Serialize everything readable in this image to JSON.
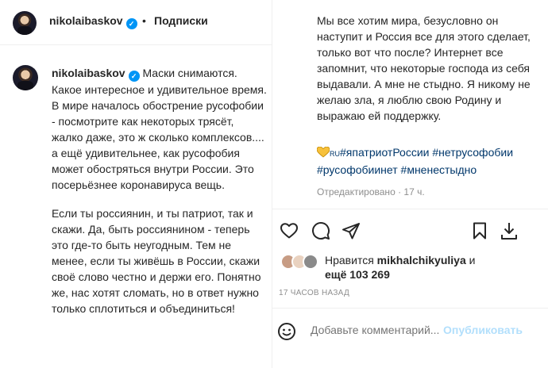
{
  "header": {
    "username": "nikolaibaskov",
    "separator": "•",
    "follow_label": "Подписки"
  },
  "caption": {
    "username": "nikolaibaskov",
    "paragraph1": "Маски снимаются. Какое интересное и удивительное время. В мире началось обострение русофобии - посмотрите как некоторых трясёт, жалко даже, это ж сколько комплексов.... а ещё удивительнее, как русофобия может обостряться внутри России. Это посерьёзнее коронавируса вещь.",
    "paragraph2": "Если ты россиянин, и ты патриот, так и скажи. Да, быть россиянином - теперь это где-то быть неугодным. Тем не менее, если ты живёшь в России, скажи своё слово честно и держи его. Понятно же, нас хотят сломать, но в ответ нужно только сплотиться и объединиться!"
  },
  "right": {
    "paragraph3": "Мы все хотим мира, безусловно он наступит и Россия все для этого сделает, только вот что после? Интернет все запомнит, что некоторые господа из себя выдавали. А мне не стыдно. Я никому не желаю зла, я люблю свою Родину и выражаю ей поддержку.",
    "ru_label": "RU",
    "tags": [
      "#япатриотРоссии",
      "#нетрусофобии",
      "#русофобиинет",
      "#мненестыдно"
    ],
    "edited": "Отредактировано · 17 ч."
  },
  "likes": {
    "prefix": "Нравится",
    "user": "mikhalchikyuliya",
    "conj": "и",
    "more": "ещё 103 269"
  },
  "timestamp": "17 ЧАСОВ НАЗАД",
  "comment": {
    "placeholder": "Добавьте комментарий...",
    "publish_label": "Опубликовать"
  },
  "icons": [
    "heart-icon",
    "comment-icon",
    "share-icon",
    "bookmark-icon",
    "download-icon",
    "emoji-icon",
    "verified-icon"
  ],
  "colors": {
    "link": "#00376b",
    "verified": "#0095f6",
    "publish_disabled": "#b2dffc",
    "muted": "#8e8e8e"
  }
}
